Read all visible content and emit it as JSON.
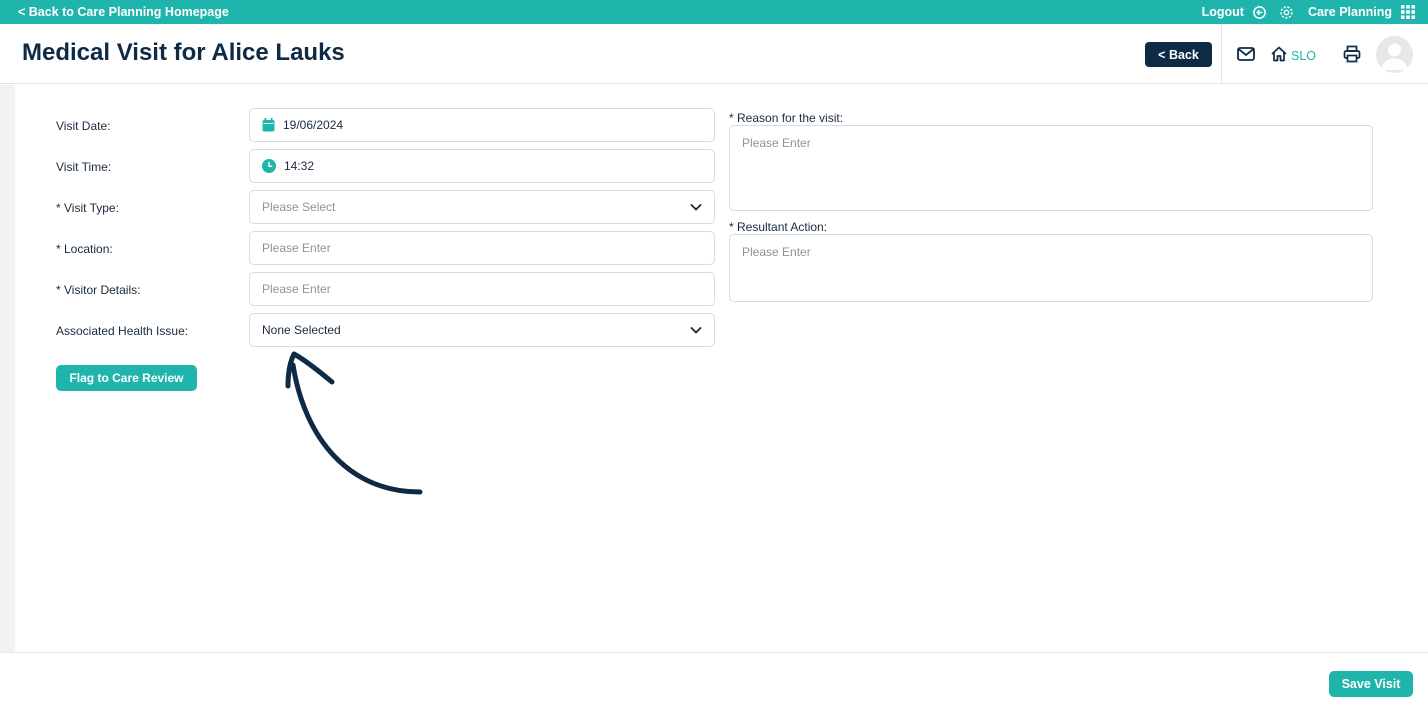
{
  "topbar": {
    "back_link": "< Back to Care Planning Homepage",
    "logout": "Logout",
    "app_name": "Care Planning",
    "icons": [
      "logout-icon",
      "settings-icon",
      "apps-grid-icon"
    ]
  },
  "header": {
    "title": "Medical Visit for Alice Lauks",
    "back_button": "< Back",
    "home_label": "SLO",
    "icons": [
      "mail-icon",
      "home-icon",
      "printer-icon",
      "avatar"
    ]
  },
  "form": {
    "visit_date": {
      "label": "Visit Date:",
      "value": "19/06/2024",
      "icon": "calendar-icon"
    },
    "visit_time": {
      "label": "Visit Time:",
      "value": "14:32",
      "icon": "clock-icon"
    },
    "visit_type": {
      "label": "* Visit Type:",
      "placeholder": "Please Select"
    },
    "location": {
      "label": "* Location:",
      "placeholder": "Please Enter"
    },
    "visitor_details": {
      "label": "* Visitor Details:",
      "placeholder": "Please Enter"
    },
    "health_issue": {
      "label": "Associated Health Issue:",
      "value": "None Selected"
    },
    "reason": {
      "label": "* Reason for the visit:",
      "placeholder": "Please Enter"
    },
    "resultant_action": {
      "label": "* Resultant Action:",
      "placeholder": "Please Enter"
    },
    "flag_button": "Flag to Care Review"
  },
  "footer": {
    "save_button": "Save Visit"
  },
  "colors": {
    "teal": "#1fb5ad",
    "navy": "#0f2a44",
    "background": "#f1f2f4"
  }
}
